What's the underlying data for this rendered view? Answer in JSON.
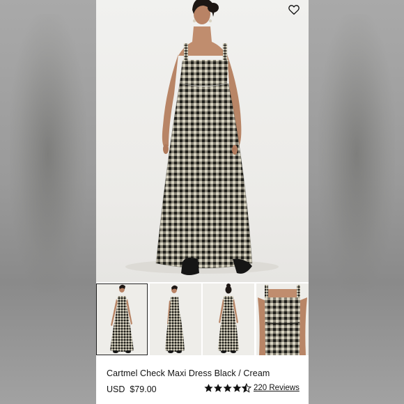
{
  "product": {
    "title": "Cartmel Check Maxi Dress Black / Cream",
    "currency": "USD",
    "price": "$79.00",
    "rating": 4.5,
    "reviews_label": "220 Reviews"
  },
  "gallery": {
    "selected_index": 0,
    "thumbnails": [
      "front-full",
      "side-full",
      "back-full",
      "bodice-closeup"
    ]
  },
  "icons": {
    "wishlist": "heart-outline-icon",
    "rating": "star-icon"
  },
  "colors": {
    "text": "#111111",
    "check_dark": "#2a2a24",
    "check_light": "#d8d4c2",
    "hero_bg": "#eeede9"
  }
}
